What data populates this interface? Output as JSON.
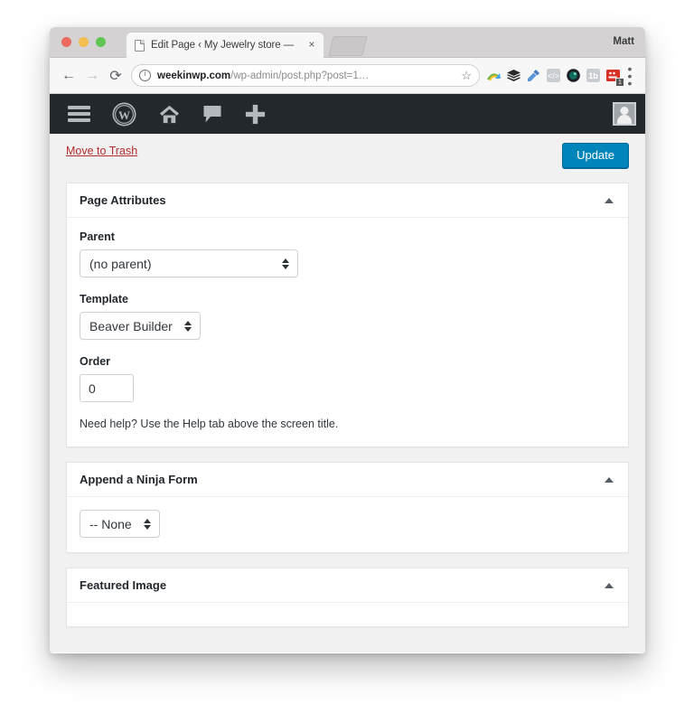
{
  "browser": {
    "traffic_lights": [
      "close-red",
      "minimize-yellow",
      "maximize-green"
    ],
    "tab": {
      "title": "Edit Page ‹ My Jewelry store —",
      "favicon": "page-icon",
      "close_label": "×"
    },
    "new_tab_label": "",
    "profile_name": "Matt",
    "nav": {
      "back": "←",
      "forward": "→",
      "reload": "⟳"
    },
    "omnibox": {
      "security_icon": "info-icon",
      "host": "weekinwp.com",
      "path": "/wp-admin/post.php?post=1…",
      "bookmark_icon": "☆"
    },
    "extensions": [
      {
        "name": "rainbow-arc-icon",
        "badge": ""
      },
      {
        "name": "layers-stack-icon",
        "badge": ""
      },
      {
        "name": "eyedropper-icon",
        "badge": ""
      },
      {
        "name": "code-brackets-icon",
        "badge": ""
      },
      {
        "name": "camera-lens-icon",
        "badge": ""
      },
      {
        "name": "one-b-icon",
        "badge": ""
      },
      {
        "name": "red-recorder-icon",
        "badge": "1"
      }
    ],
    "menu_icon": "kebab-menu-icon"
  },
  "wp_adminbar": {
    "items": [
      {
        "name": "menu-toggle",
        "icon": "hamburger-icon"
      },
      {
        "name": "wordpress-logo",
        "icon": "wordpress-icon"
      },
      {
        "name": "site-home",
        "icon": "home-icon"
      },
      {
        "name": "comments",
        "icon": "comment-bubble-icon"
      },
      {
        "name": "new-content",
        "icon": "plus-icon"
      }
    ],
    "account": {
      "name": "account-avatar",
      "icon": "user-avatar-icon"
    }
  },
  "submit_row": {
    "trash_label": "Move to Trash",
    "update_label": "Update",
    "update_color": "#0085ba",
    "trash_color": "#b32d2e"
  },
  "panels": [
    {
      "title": "Page Attributes",
      "collapse_icon": "triangle-up-icon",
      "fields": [
        {
          "label": "Parent",
          "type": "select",
          "value": "(no parent)"
        },
        {
          "label": "Template",
          "type": "select",
          "value": "Beaver Builder"
        },
        {
          "label": "Order",
          "type": "number",
          "value": "0"
        }
      ],
      "help_text": "Need help? Use the Help tab above the screen title."
    },
    {
      "title": "Append a Ninja Form",
      "collapse_icon": "triangle-up-icon",
      "fields": [
        {
          "label": "",
          "type": "select",
          "value": "-- None"
        }
      ]
    },
    {
      "title": "Featured Image",
      "collapse_icon": "triangle-up-icon",
      "fields": []
    }
  ]
}
